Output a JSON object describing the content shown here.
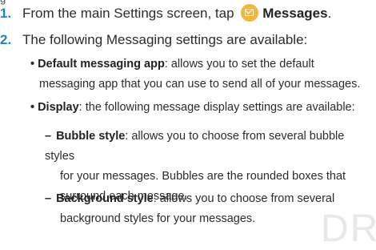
{
  "top_fragment": "g",
  "steps": [
    {
      "number": "1.",
      "text_before": "From the main Settings screen, tap",
      "icon": "messages-envelope-icon",
      "icon_color": "#f5b53a",
      "bold_label": "Messages",
      "text_after": "."
    },
    {
      "number": "2.",
      "text": "The following Messaging settings are available:"
    }
  ],
  "bullets": [
    {
      "symbol": "•",
      "label": "Default messaging app",
      "line1": ": allows you to set the default",
      "line2": "messaging app that you can use to send all of your messages."
    },
    {
      "symbol": "•",
      "label": "Display",
      "line1": ": the following message display settings are available:"
    }
  ],
  "sub_bullets": [
    {
      "symbol": "–",
      "label": "Bubble style",
      "line1": ": allows you to choose from several bubble styles",
      "line2": "for your messages. Bubbles are the rounded boxes that",
      "line3": "surround each message."
    },
    {
      "symbol": "–",
      "label": "Background style",
      "line1": ": allows you to choose from several",
      "line2": "background styles for your messages."
    }
  ],
  "watermark": "DR",
  "colors": {
    "step_number": "#1a86c8",
    "text": "#2b2b2b",
    "watermark": "#e8e8e8"
  }
}
